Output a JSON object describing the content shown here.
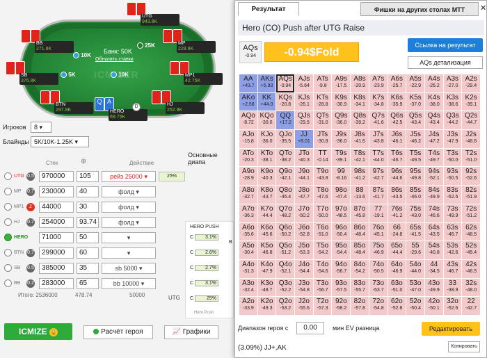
{
  "table": {
    "bank": "Банк: 50K",
    "reset": "Обнулить ставки",
    "watermark": "ICMIZER",
    "pot_chip_1": "10K",
    "pot_chip_2": "10K",
    "chip_25k": "25K",
    "chip_5k": "5K",
    "chip_10k": "10K",
    "seats": [
      {
        "pos": "UTG",
        "name": "UTG",
        "stack": "943.8K",
        "badge": "52.5",
        "bb": "97"
      },
      {
        "pos": "MP",
        "name": "MP",
        "stack": "228.8K",
        "badge": "10.35",
        "bb": "23"
      },
      {
        "pos": "MP1",
        "name": "MP1",
        "stack": "42.75K",
        "badge": "1.4",
        "bb": "4.4"
      },
      {
        "pos": "HJ",
        "name": "HJ",
        "stack": "252.8K",
        "badge": "46.87",
        "bb": "25"
      },
      {
        "pos": "HERO",
        "name": "HERO",
        "stack": "69.75K",
        "badge": "25",
        "bb": "7"
      },
      {
        "pos": "BTN",
        "name": "BTN",
        "stack": "297.8K",
        "badge": "30",
        "bb": "30"
      },
      {
        "pos": "SB",
        "name": "SB",
        "stack": "376.8K",
        "badge": "17.5",
        "bb": "38"
      },
      {
        "pos": "BB",
        "name": "BB",
        "stack": "271.8K",
        "badge": "32.5",
        "bb": "27"
      }
    ],
    "hero_cards": [
      "Q",
      "A"
    ]
  },
  "settings": {
    "players_label": "Игроков",
    "players_value": "8",
    "blinds_label": "Блайнды",
    "blinds_value": "5K/10K-1.25K",
    "stack_hdr": "Стек",
    "action_hdr": "Действие",
    "ranges_label": "Основные диапа"
  },
  "rows": [
    {
      "pos": "UTG",
      "badge": "0.5",
      "stack": "970000",
      "bb": "105",
      "action": "рейз 25000",
      "pct": "25%",
      "red": true
    },
    {
      "pos": "MP",
      "badge": "0.7",
      "stack": "230000",
      "bb": "40",
      "action": "фолд",
      "pct": "",
      "red": false
    },
    {
      "pos": "MP1",
      "badge": "2",
      "stack": "44000",
      "bb": "30",
      "action": "фолд",
      "pct": "",
      "red": false
    },
    {
      "pos": "HJ",
      "badge": "0.7",
      "stack": "254000",
      "bb": "93.74",
      "action": "фолд",
      "pct": "",
      "red": false
    },
    {
      "pos": "HERO",
      "badge": "",
      "stack": "71000",
      "bb": "50",
      "action": "",
      "pct": "",
      "red": false
    },
    {
      "pos": "BTN",
      "badge": "0.7",
      "stack": "299000",
      "bb": "60",
      "action": "",
      "pct": "",
      "red": false
    },
    {
      "pos": "SB",
      "badge": "0.5",
      "stack": "385000",
      "bb": "35",
      "action": "sb 5000",
      "pct": "",
      "red": false
    },
    {
      "pos": "BB",
      "badge": "0.2",
      "stack": "283000",
      "bb": "65",
      "action": "bb 10000",
      "pct": "",
      "red": false
    }
  ],
  "totals": {
    "label": "Итого: 2536000",
    "bb": "478.74",
    "action": "50000",
    "utg": "UTG"
  },
  "mini_ranges": {
    "title": "HERO PUSH",
    "rows": [
      {
        "label": "C",
        "value": "3.1%"
      },
      {
        "label": "C",
        "value": "2.6%"
      },
      {
        "label": "C",
        "value": "2.7%"
      },
      {
        "label": "C",
        "value": "3.1%"
      },
      {
        "label": "C",
        "value": "25%"
      }
    ],
    "footer": "Hero Push",
    "b_label": "B"
  },
  "buttons": {
    "icmize": "ICMIZE",
    "calc": "Расчёт героя",
    "graphs": "Графики"
  },
  "result": {
    "tab": "Результат",
    "tab2": "Фишки на других столах МТТ",
    "title": "Hero (CO) Push after UTG Raise",
    "hand": "AQs",
    "hand_ev": "-0.94",
    "result": "-0.94$Fold",
    "link_btn": "Ссылка на результат",
    "detail_btn": "AQs детализация",
    "range_label": "Диапазон героя с",
    "ev_value": "0.00",
    "ev_label": "мин EV разница",
    "edit_btn": "Редактировать",
    "range_text": "(3.09%) JJ+,AK",
    "copy_btn": "Копировать"
  },
  "grid": [
    [
      "AA",
      "+43.7"
    ],
    [
      "AKs",
      "+5.93"
    ],
    [
      "AQs",
      "-0.94"
    ],
    [
      "AJs",
      "-5.64"
    ],
    [
      "ATs",
      "-9.8"
    ],
    [
      "A9s",
      "-17.5"
    ],
    [
      "A8s",
      "-20.9"
    ],
    [
      "A7s",
      "-23.9"
    ],
    [
      "A6s",
      "-25.7"
    ],
    [
      "A5s",
      "-22.9"
    ],
    [
      "A4s",
      "-26.2"
    ],
    [
      "A3s",
      "-27.0"
    ],
    [
      "A2s",
      "-29.4"
    ],
    [
      "AKo",
      "+2.58"
    ],
    [
      "KK",
      "+44.0"
    ],
    [
      "KQs",
      "-20.8"
    ],
    [
      "KJs",
      "-26.1"
    ],
    [
      "KTs",
      "-28.8"
    ],
    [
      "K9s",
      "-30.9"
    ],
    [
      "K8s",
      "-34.1"
    ],
    [
      "K7s",
      "-34.8"
    ],
    [
      "K6s",
      "-35.9"
    ],
    [
      "K5s",
      "-37.0"
    ],
    [
      "K4s",
      "-38.0"
    ],
    [
      "K3s",
      "-38.6"
    ],
    [
      "K2s",
      "-39.1"
    ],
    [
      "AQo",
      "-8.72"
    ],
    [
      "KQo",
      "-30.0"
    ],
    [
      "QQ",
      "+17.2"
    ],
    [
      "QJs",
      "-29.5"
    ],
    [
      "QTs",
      "-31.0"
    ],
    [
      "Q9s",
      "-36.0"
    ],
    [
      "Q8s",
      "-39.2"
    ],
    [
      "Q7s",
      "-41.6"
    ],
    [
      "Q6s",
      "-42.5"
    ],
    [
      "Q5s",
      "-43.4"
    ],
    [
      "Q4s",
      "-43.4"
    ],
    [
      "Q3s",
      "-44.2"
    ],
    [
      "Q2s",
      "-44.7"
    ],
    [
      "AJo",
      "-15.8"
    ],
    [
      "KJo",
      "-36.0"
    ],
    [
      "QJo",
      "-35.5"
    ],
    [
      "JJ",
      "+8.01"
    ],
    [
      "JTs",
      "-30.8"
    ],
    [
      "J9s",
      "-36.0"
    ],
    [
      "J8s",
      "-41.6"
    ],
    [
      "J7s",
      "-43.8"
    ],
    [
      "J6s",
      "-46.1"
    ],
    [
      "J5s",
      "-46.2"
    ],
    [
      "J4s",
      "-47.2"
    ],
    [
      "J3s",
      "-47.9"
    ],
    [
      "J2s",
      "-48.6"
    ],
    [
      "ATo",
      "-20.3"
    ],
    [
      "KTo",
      "-38.1"
    ],
    [
      "QTo",
      "-38.2"
    ],
    [
      "JTo",
      "-40.3"
    ],
    [
      "TT",
      "-0.14"
    ],
    [
      "T9s",
      "-39.1"
    ],
    [
      "T8s",
      "-42.1"
    ],
    [
      "T7s",
      "-44.0"
    ],
    [
      "T6s",
      "-46.7"
    ],
    [
      "T5s",
      "-49.5"
    ],
    [
      "T4s",
      "-49.7"
    ],
    [
      "T3s",
      "-50.0"
    ],
    [
      "T2s",
      "-51.0"
    ],
    [
      "A9o",
      "-28.9"
    ],
    [
      "K9o",
      "-40.3"
    ],
    [
      "Q9o",
      "-42.1"
    ],
    [
      "J9o",
      "-44.1"
    ],
    [
      "T9o",
      "-43.8"
    ],
    [
      "99",
      "-8.16"
    ],
    [
      "98s",
      "-41.2"
    ],
    [
      "97s",
      "-42.7"
    ],
    [
      "96s",
      "-44.6"
    ],
    [
      "95s",
      "-49.8"
    ],
    [
      "94s",
      "-52.1"
    ],
    [
      "93s",
      "-50.5"
    ],
    [
      "92s",
      "-52.6"
    ],
    [
      "A8o",
      "-32.7"
    ],
    [
      "K8o",
      "-43.7"
    ],
    [
      "Q8o",
      "-45.4"
    ],
    [
      "J8o",
      "-47.7"
    ],
    [
      "T8o",
      "-47.6"
    ],
    [
      "98o",
      "-47.4"
    ],
    [
      "88",
      "-13.6"
    ],
    [
      "87s",
      "-41.7"
    ],
    [
      "86s",
      "-43.5"
    ],
    [
      "85s",
      "-46.0"
    ],
    [
      "84s",
      "-49.9"
    ],
    [
      "83s",
      "-52.5"
    ],
    [
      "82s",
      "-51.9"
    ],
    [
      "A7o",
      "-36.3"
    ],
    [
      "K7o",
      "-44.4"
    ],
    [
      "Q7o",
      "-48.2"
    ],
    [
      "J7o",
      "-50.2"
    ],
    [
      "T7o",
      "-50.0"
    ],
    [
      "97o",
      "-48.5"
    ],
    [
      "87o",
      "-45.8"
    ],
    [
      "77",
      "-19.1"
    ],
    [
      "76s",
      "-41.2"
    ],
    [
      "75s",
      "-43.0"
    ],
    [
      "74s",
      "-46.6"
    ],
    [
      "73s",
      "-49.9"
    ],
    [
      "72s",
      "-51.2"
    ],
    [
      "A6o",
      "-35.6"
    ],
    [
      "K6o",
      "-45.6"
    ],
    [
      "Q6o",
      "-50.2"
    ],
    [
      "J6o",
      "-52.8"
    ],
    [
      "T6o",
      "-51.0"
    ],
    [
      "96o",
      "-50.4"
    ],
    [
      "86o",
      "-48.4"
    ],
    [
      "76o",
      "-45.1"
    ],
    [
      "66",
      "-24.8"
    ],
    [
      "65s",
      "-41.5"
    ],
    [
      "64s",
      "-43.5"
    ],
    [
      "63s",
      "-46.7"
    ],
    [
      "62s",
      "-48.5"
    ],
    [
      "A5o",
      "-30.4"
    ],
    [
      "K5o",
      "-46.8"
    ],
    [
      "Q5o",
      "-51.2"
    ],
    [
      "J5o",
      "-53.3"
    ],
    [
      "T5o",
      "-54.2"
    ],
    [
      "95o",
      "-54.4"
    ],
    [
      "85o",
      "-48.4"
    ],
    [
      "75o",
      "-46.9"
    ],
    [
      "65o",
      "-44.4"
    ],
    [
      "55",
      "-29.6"
    ],
    [
      "54s",
      "-40.8"
    ],
    [
      "53s",
      "-42.6"
    ],
    [
      "52s",
      "-45.4"
    ],
    [
      "A4o",
      "-31.3"
    ],
    [
      "K4o",
      "-47.9"
    ],
    [
      "Q4o",
      "-52.1"
    ],
    [
      "J4o",
      "-54.4"
    ],
    [
      "T4o",
      "-54.6"
    ],
    [
      "94o",
      "-56.7"
    ],
    [
      "84o",
      "-54.2"
    ],
    [
      "74o",
      "-50.5"
    ],
    [
      "64o",
      "-46.9"
    ],
    [
      "54o",
      "-44.0"
    ],
    [
      "44",
      "-34.5"
    ],
    [
      "43s",
      "-46.7"
    ],
    [
      "42s",
      "-46.5"
    ],
    [
      "A3o",
      "-32.4"
    ],
    [
      "K3o",
      "-48.7"
    ],
    [
      "Q3o",
      "-52.2"
    ],
    [
      "J3o",
      "-54.8"
    ],
    [
      "T3o",
      "-56.7"
    ],
    [
      "93o",
      "-57.5"
    ],
    [
      "83o",
      "-55.7"
    ],
    [
      "73o",
      "-53.7"
    ],
    [
      "63o",
      "-51.0"
    ],
    [
      "53o",
      "-47.0"
    ],
    [
      "43o",
      "-49.9"
    ],
    [
      "33",
      "-38.9"
    ],
    [
      "32s",
      "-48.0"
    ],
    [
      "A2o",
      "-33.9"
    ],
    [
      "K2o",
      "-49.3"
    ],
    [
      "Q2o",
      "-53.2"
    ],
    [
      "J2o",
      "-55.6"
    ],
    [
      "T2o",
      "-57.3"
    ],
    [
      "92o",
      "-58.2"
    ],
    [
      "82o",
      "-57.8"
    ],
    [
      "72o",
      "-54.8"
    ],
    [
      "62o",
      "-52.8"
    ],
    [
      "52o",
      "-50.4"
    ],
    [
      "42o",
      "-50.1"
    ],
    [
      "32o",
      "-52.6"
    ],
    [
      "22",
      "-42.7"
    ]
  ],
  "push_hands": [
    "AA",
    "AKs",
    "AKo",
    "KK",
    "QQ",
    "JJ"
  ],
  "highlight_hand": "AQs"
}
